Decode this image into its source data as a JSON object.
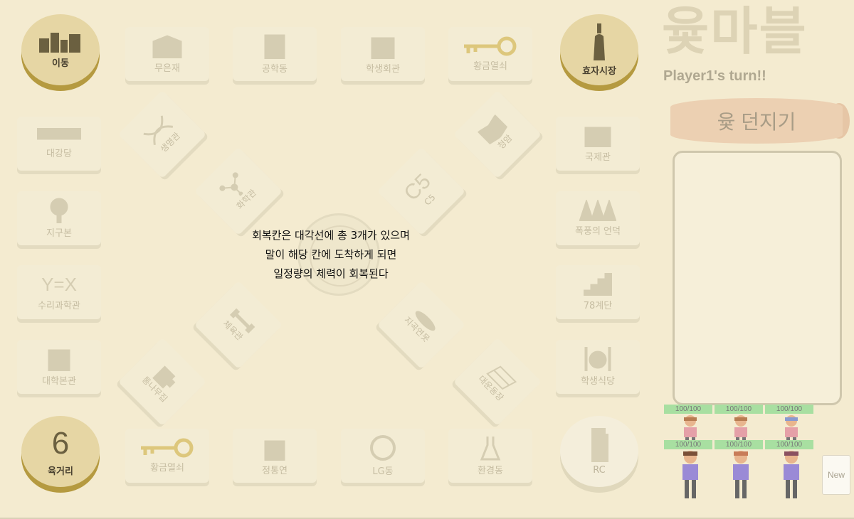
{
  "game": {
    "logo": "윷마블",
    "turn_text": "Player1's turn!!",
    "throw_button": "윷 던지기",
    "new_button": "New"
  },
  "corners": {
    "top_left": "이동",
    "top_right": "효자시장",
    "bottom_left_label": "육거리",
    "bottom_left_number": "6",
    "bottom_right": "RC"
  },
  "top_row": [
    "무은재",
    "공학동",
    "학생회관",
    "황금열쇠"
  ],
  "bottom_row": [
    "황금열쇠",
    "정통연",
    "LG동",
    "환경동"
  ],
  "left_col": [
    "대강당",
    "지구본",
    "수리과학관",
    "대학본관"
  ],
  "left_col_icon_text": "Y=X",
  "right_col": [
    "국제관",
    "폭풍의 언덕",
    "78계단",
    "학생식당"
  ],
  "diagonals": {
    "nw_outer": "생명관",
    "nw_inner": "화학관",
    "ne_outer": "청암",
    "ne_inner": "C5",
    "ne_inner_icon_text": "C5",
    "sw_inner": "체육관",
    "sw_outer": "통나무집",
    "se_inner": "지곡연못",
    "se_outer": "대운동장"
  },
  "message": {
    "line1": "회복칸은 대각선에 총 3개가 있으며",
    "line2": "말이 해당 칸에 도착하게 되면",
    "line3": "일정량의 체력이 회복된다"
  },
  "players_hp": [
    "100/100",
    "100/100",
    "100/100",
    "100/100",
    "100/100",
    "100/100"
  ]
}
